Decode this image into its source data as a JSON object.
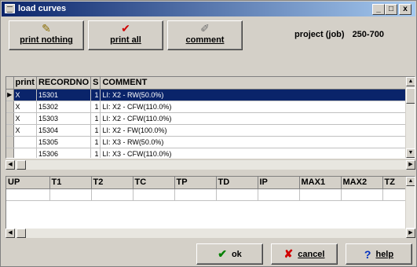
{
  "window": {
    "title": "load curves",
    "min_label": "_",
    "max_label": "□",
    "close_label": "x"
  },
  "toolbar": [
    {
      "label": "print nothing",
      "icon": "pencil-icon",
      "glyph": "✎"
    },
    {
      "label": "print all",
      "icon": "checkmark-icon",
      "glyph": "✔"
    },
    {
      "label": "comment",
      "icon": "paper-icon",
      "glyph": "✐"
    }
  ],
  "project": {
    "label": "project (job)",
    "value": "250-700"
  },
  "records": {
    "columns": [
      "print",
      "RECORDNO",
      "S",
      "COMMENT"
    ],
    "rows": [
      {
        "print": "X",
        "recordno": "15301",
        "s": "1",
        "comment": "LI: X2 - RW(50.0%)",
        "selected": true
      },
      {
        "print": "X",
        "recordno": "15302",
        "s": "1",
        "comment": "LI: X2 - CFW(110.0%)"
      },
      {
        "print": "X",
        "recordno": "15303",
        "s": "1",
        "comment": "LI: X2 - CFW(110.0%)"
      },
      {
        "print": "X",
        "recordno": "15304",
        "s": "1",
        "comment": "LI: X2 - FW(100.0%)"
      },
      {
        "print": "",
        "recordno": "15305",
        "s": "1",
        "comment": "LI: X3 - RW(50.0%)"
      },
      {
        "print": "",
        "recordno": "15306",
        "s": "1",
        "comment": "LI: X3 - CFW(110.0%)"
      }
    ]
  },
  "params": {
    "columns": [
      "UP",
      "T1",
      "T2",
      "TC",
      "TP",
      "TD",
      "IP",
      "MAX1",
      "MAX2",
      "TZ"
    ]
  },
  "buttons": {
    "ok": {
      "label": "ok",
      "icon": "check-icon",
      "glyph": "✔"
    },
    "cancel": {
      "label": "cancel",
      "icon": "x-icon",
      "glyph": "✘"
    },
    "help": {
      "label": "help",
      "icon": "question-icon",
      "glyph": "?"
    }
  },
  "colors": {
    "title_bar": "#0a246a",
    "selection": "#0a246a",
    "face": "#d4d0c8"
  }
}
